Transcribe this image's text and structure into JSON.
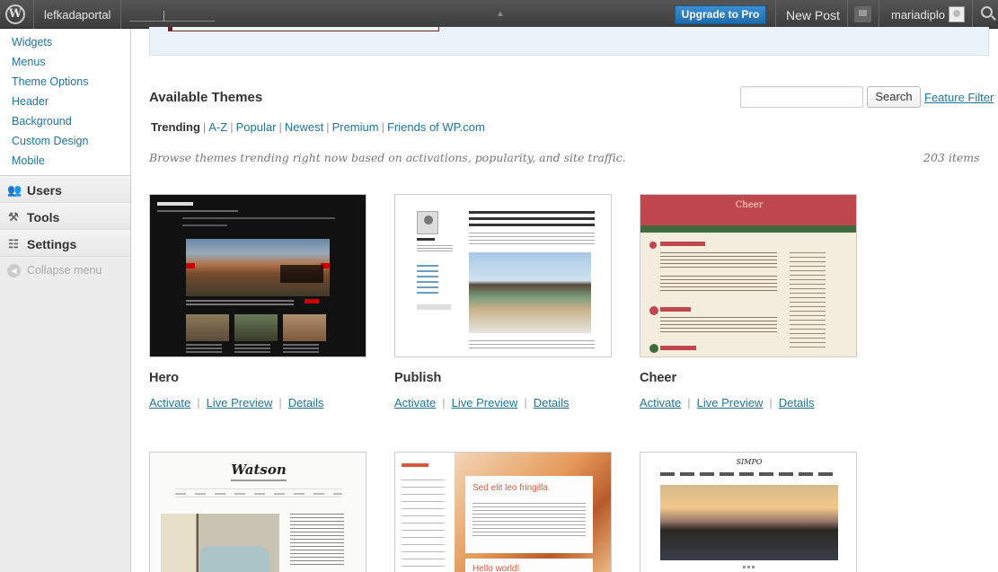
{
  "admin_bar": {
    "site_name": "lefkadaportal",
    "upgrade_label": "Upgrade to Pro",
    "new_post_label": "New Post",
    "username": "mariadiplo"
  },
  "sidebar": {
    "submenu": [
      "Widgets",
      "Menus",
      "Theme Options",
      "Header",
      "Background",
      "Custom Design",
      "Mobile"
    ],
    "items": [
      {
        "label": "Users",
        "icon": "users-icon"
      },
      {
        "label": "Tools",
        "icon": "tools-icon"
      },
      {
        "label": "Settings",
        "icon": "settings-icon"
      }
    ],
    "collapse_label": "Collapse menu"
  },
  "main": {
    "title": "Available Themes",
    "search_button": "Search",
    "feature_filter": "Feature Filter",
    "tabs": [
      "Trending",
      "A-Z",
      "Popular",
      "Newest",
      "Premium",
      "Friends of WP.com"
    ],
    "active_tab": "Trending",
    "subtitle": "Browse themes trending right now based on activations, popularity, and site traffic.",
    "count": "203 items"
  },
  "themes": [
    {
      "name": "Hero",
      "activate": "Activate",
      "preview": "Live Preview",
      "details": "Details"
    },
    {
      "name": "Publish",
      "activate": "Activate",
      "preview": "Live Preview",
      "details": "Details"
    },
    {
      "name": "Cheer",
      "activate": "Activate",
      "preview": "Live Preview",
      "details": "Details"
    }
  ],
  "theme_screenshots": {
    "cheer_title": "Cheer",
    "watson_logo": "Watson",
    "confit_post_title": "Sed elit leo fringilla",
    "confit_post_title_2": "Hello world!",
    "simpo_logo": "SIMPO"
  }
}
